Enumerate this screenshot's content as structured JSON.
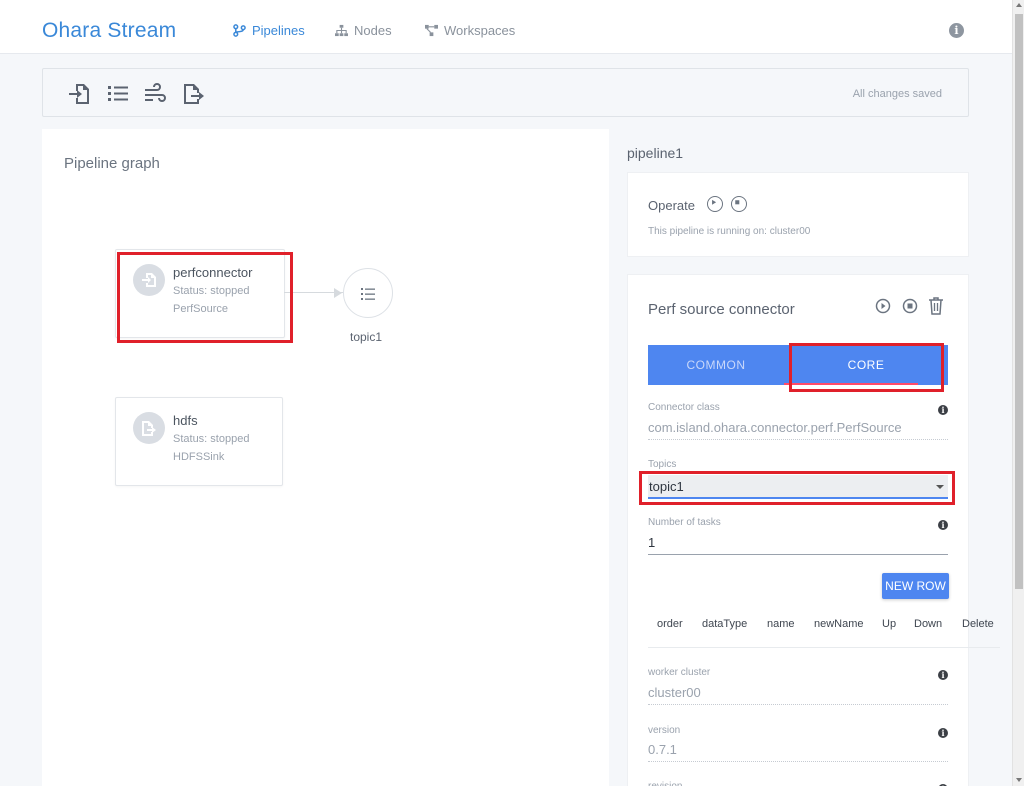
{
  "nav": {
    "brand": "Ohara Stream",
    "links": [
      {
        "label": "Pipelines",
        "active": true,
        "icon": "branch-icon"
      },
      {
        "label": "Nodes",
        "active": false,
        "icon": "sitemap-icon"
      },
      {
        "label": "Workspaces",
        "active": false,
        "icon": "project-diagram-icon"
      }
    ],
    "info_glyph": "i"
  },
  "toolbar": {
    "icons": [
      "add-source-icon",
      "add-topic-icon",
      "add-stream-icon",
      "add-sink-icon"
    ],
    "status": "All changes saved"
  },
  "graph": {
    "title": "Pipeline graph",
    "nodes": [
      {
        "name": "perfconnector",
        "status": "Status: stopped",
        "kind": "PerfSource"
      },
      {
        "name": "hdfs",
        "status": "Status: stopped",
        "kind": "HDFSSink"
      }
    ],
    "topic": {
      "name": "topic1"
    }
  },
  "pipeline": {
    "name": "pipeline1",
    "operate_label": "Operate",
    "running_text": "This pipeline is running on: cluster00"
  },
  "connector": {
    "title": "Perf source connector",
    "tabs": [
      "COMMON",
      "CORE"
    ],
    "active_tab": "CORE",
    "fields": {
      "connector_class": {
        "label": "Connector class",
        "value": "com.island.ohara.connector.perf.PerfSource"
      },
      "topics": {
        "label": "Topics",
        "value": "topic1"
      },
      "tasks": {
        "label": "Number of tasks",
        "value": "1"
      },
      "worker_cluster": {
        "label": "worker cluster",
        "value": "cluster00"
      },
      "version": {
        "label": "version",
        "value": "0.7.1"
      },
      "revision": {
        "label": "revision"
      }
    },
    "new_row_label": "NEW ROW",
    "columns": [
      "order",
      "dataType",
      "name",
      "newName",
      "Up",
      "Down",
      "Delete"
    ]
  },
  "colors": {
    "brand": "#3a88d8",
    "primary": "#4e86f0",
    "tab_indicator": "#ff4b6a",
    "highlight": "#e0202a"
  }
}
